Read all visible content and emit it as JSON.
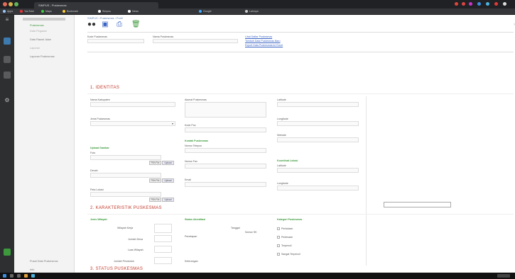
{
  "browser": {
    "tab_title": "SIMPUS - Puskesmas",
    "bookmarks": [
      "Apps",
      "YouTube",
      "Maps",
      "Bookmark",
      "Simpus",
      "News",
      "Google",
      "Lainnya"
    ]
  },
  "nav": {
    "items": [
      "Puskesmas",
      "Data Pegawai",
      "Data Rawat Jalan",
      "Laporan",
      "Laporan Puskesmas"
    ],
    "bottom_items": [
      "Pusat Data Puskesmas",
      "Info"
    ]
  },
  "page": {
    "breadcrumb": "SIMPUS › Puskesmas › Profil",
    "top_links": [
      "Lihat Daftar Puskesmas",
      "Tambah Data Puskesmas Baru",
      "Export Data Puskesmas ke Excel"
    ],
    "top_fields": {
      "kode_label": "Kode Puskesmas",
      "kode_value": "",
      "nama_label": "Nama Puskesmas",
      "nama_value": ""
    },
    "section1": "1. IDENTITAS",
    "col1": {
      "f1_label": "Nama Kabupaten",
      "f1_value": "",
      "f2_label": "Jenis Puskesmas",
      "f2_value": "",
      "group_label": "Upload Gambar",
      "foto_label": "Foto",
      "foto_hint": "",
      "denah_label": "Denah",
      "denah_hint": "",
      "peta_label": "Peta Lokasi",
      "peta_hint": "",
      "pilih": "Pilih File",
      "upload": "Upload"
    },
    "col2": {
      "alamat_label": "Alamat Puskesmas",
      "alamat_value": "",
      "kode_pos_label": "Kode Pos",
      "group_label": "Kontak Puskesmas",
      "telp_label": "Nomor Telepon",
      "telp_value": "",
      "fax_label": "Nomor Fax",
      "fax_value": "",
      "email_label": "Email",
      "email_value": ""
    },
    "col3": {
      "lat_label": "Latitude",
      "lat_value": "",
      "long_label": "Longitude",
      "long_value": "",
      "web_label": "Website",
      "web_value": "",
      "group_label": "Koordinat Lokasi",
      "k_lat_label": "Latitude",
      "k_lat_value": "",
      "k_long_label": "Longitude",
      "k_long_value": ""
    },
    "search_input": "",
    "section2": "2. KARAKTERISTIK PUSKESMAS",
    "sec2_col1": {
      "group_label": "Jenis Wilayah",
      "rows": [
        "Wilayah Kerja",
        "Jumlah Desa",
        "Luas Wilayah",
        "Jumlah Penduduk"
      ]
    },
    "sec2_col2": {
      "group_label": "Status Akreditasi",
      "lines": [
        "Tanggal",
        "Nomor SK",
        "Penetapan",
        "Keterangan"
      ]
    },
    "sec2_col3": {
      "group_label": "Kategori Puskesmas",
      "checks": [
        "Perkotaan",
        "Pedesaan",
        "Terpencil",
        "Sangat Terpencil"
      ]
    },
    "section3": "3. STATUS PUSKESMAS"
  }
}
